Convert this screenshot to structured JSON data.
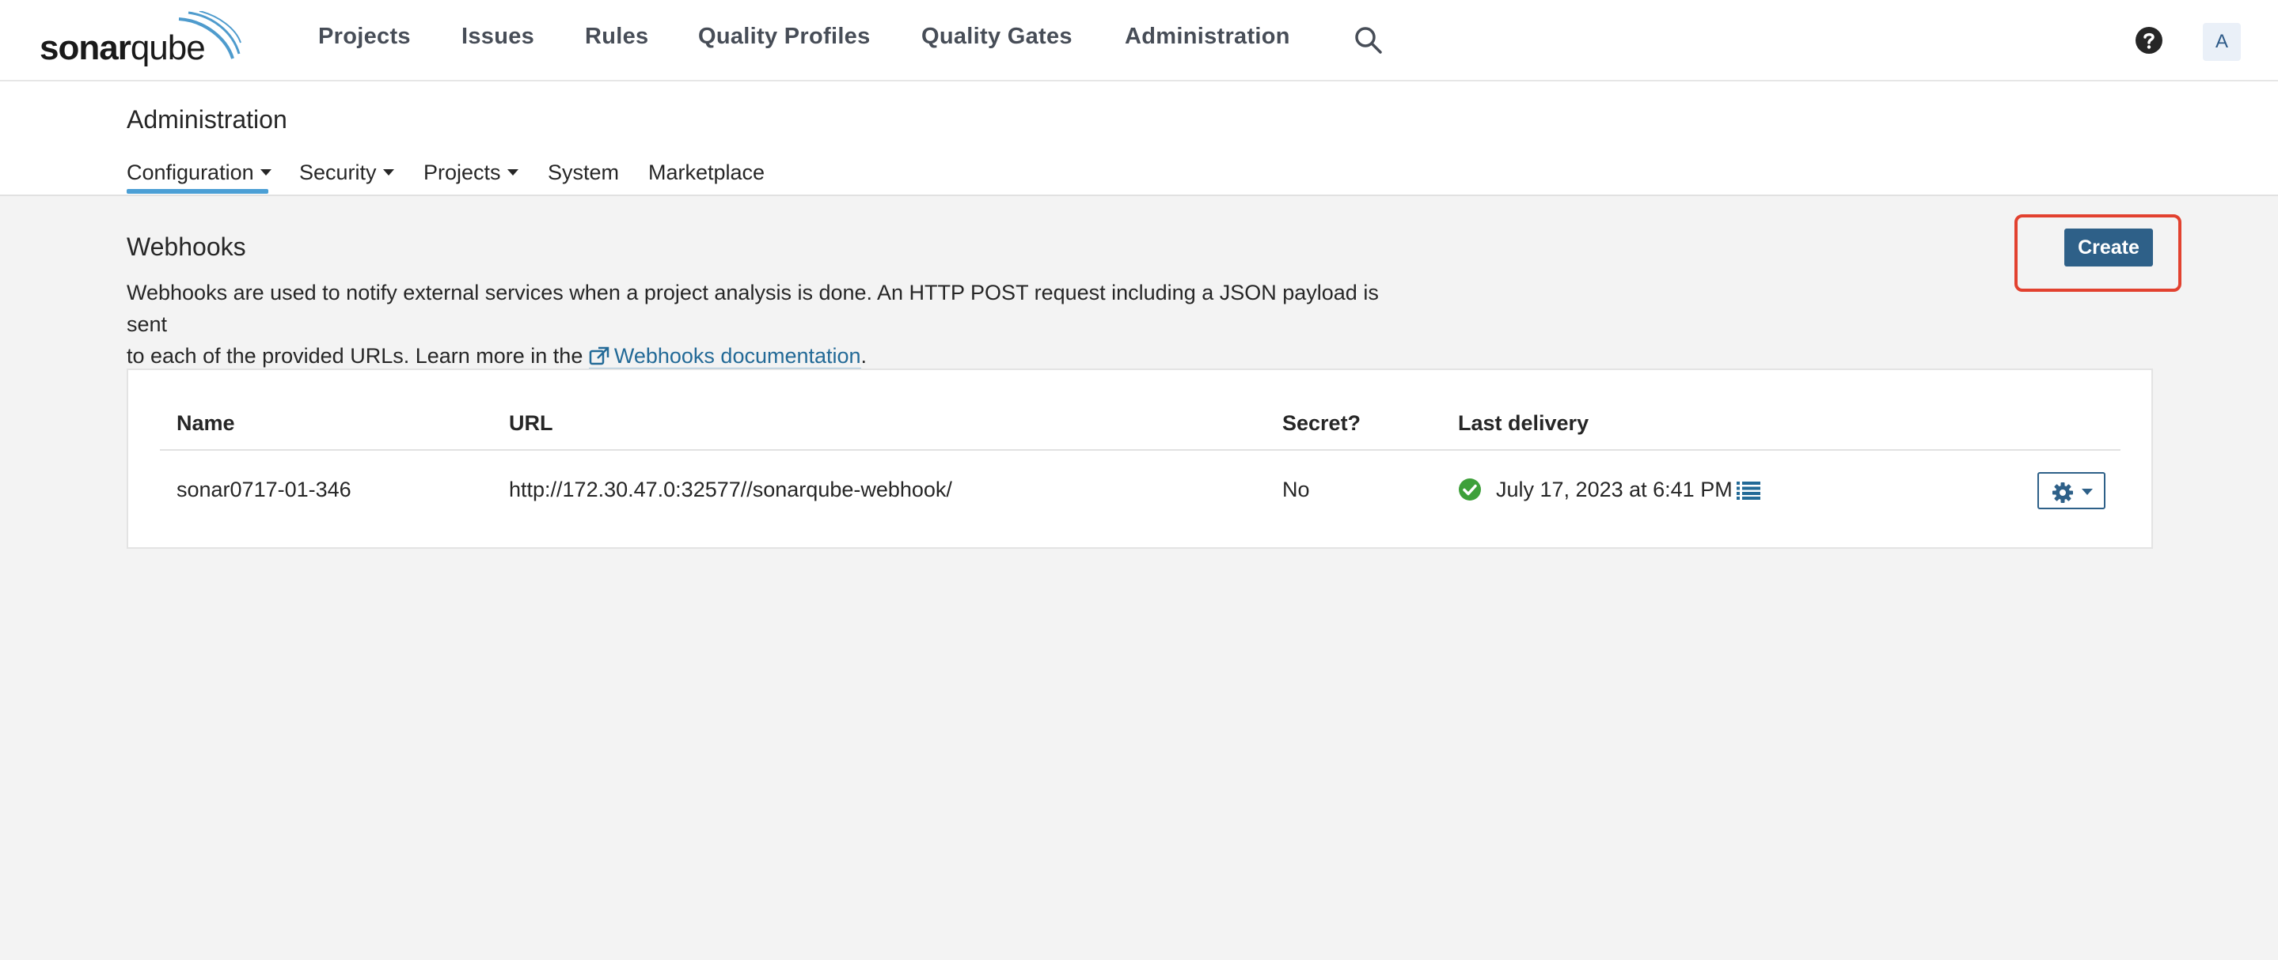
{
  "brand": {
    "logo_text_bold": "sonar",
    "logo_text_light": "qube"
  },
  "topnav": {
    "items": [
      {
        "label": "Projects"
      },
      {
        "label": "Issues"
      },
      {
        "label": "Rules"
      },
      {
        "label": "Quality Profiles"
      },
      {
        "label": "Quality Gates"
      },
      {
        "label": "Administration"
      }
    ],
    "search_icon": "search-icon",
    "help_icon": "help-icon",
    "avatar_initial": "A"
  },
  "admin": {
    "title": "Administration",
    "tabs": [
      {
        "label": "Configuration",
        "has_dropdown": true,
        "active": true
      },
      {
        "label": "Security",
        "has_dropdown": true
      },
      {
        "label": "Projects",
        "has_dropdown": true
      },
      {
        "label": "System"
      },
      {
        "label": "Marketplace"
      }
    ]
  },
  "webhooks": {
    "title": "Webhooks",
    "description_line1": "Webhooks are used to notify external services when a project analysis is done. An HTTP POST request including a JSON payload is sent",
    "description_line2_prefix": "to each of the provided URLs. Learn more in the ",
    "doc_link_label": "Webhooks documentation",
    "description_line2_suffix": ".",
    "create_label": "Create",
    "table": {
      "columns": [
        "Name",
        "URL",
        "Secret?",
        "Last delivery"
      ],
      "rows": [
        {
          "name": "sonar0717-01-346",
          "url": "http://172.30.47.0:32577//sonarqube-webhook/",
          "secret": "No",
          "last_delivery": "July 17, 2023 at 6:41 PM",
          "delivery_status": "success"
        }
      ]
    }
  },
  "colors": {
    "primary": "#2e6088",
    "highlight": "#e2412f",
    "success": "#3ea03a",
    "tab_active": "#4b9fd5"
  }
}
